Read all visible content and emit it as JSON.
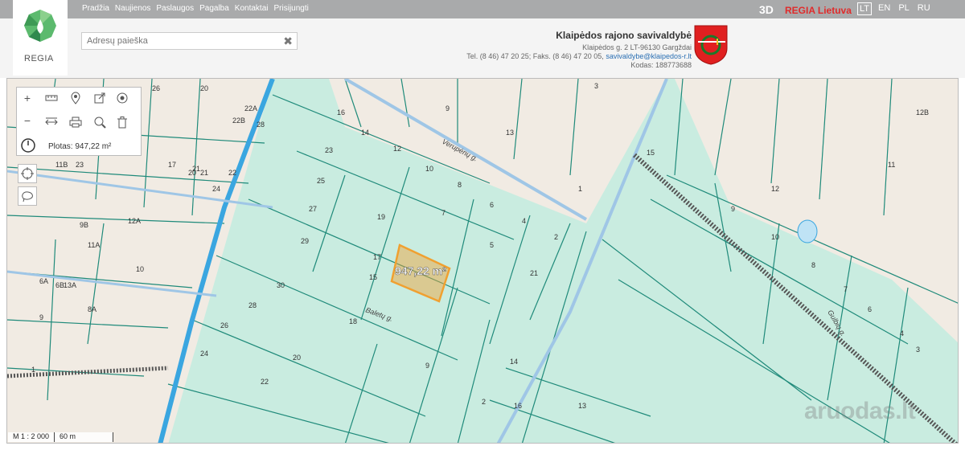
{
  "nav": {
    "items": [
      "Pradžia",
      "Naujienos",
      "Paslaugos",
      "Pagalba",
      "Kontaktai",
      "Prisijungti"
    ],
    "three_d": "3D",
    "regia_lietuva": "REGIA Lietuva",
    "languages": [
      "LT",
      "EN",
      "PL",
      "RU"
    ],
    "active_language": "LT"
  },
  "brand": {
    "name": "REGIA"
  },
  "search": {
    "placeholder": "Adresų paieška",
    "value": ""
  },
  "municipality": {
    "name": "Klaipėdos rajono savivaldybė",
    "address": "Klaipėdos g. 2 LT-96130 Gargždai",
    "phones": "Tel. (8 46) 47 20 25; Faks. (8 46) 47 20 05,",
    "email": "savivaldybe@klaipedos-r.lt",
    "code": "Kodas: 188773688"
  },
  "tools": {
    "area_label": "Plotas: 947,22 m²"
  },
  "map": {
    "measure_label": "947,22 m²",
    "streets": [
      "Verupėnų g.",
      "Baletų g.",
      "Gulbių g."
    ],
    "parcel_numbers": [
      "3",
      "9",
      "13",
      "12B",
      "16",
      "14",
      "12",
      "10",
      "8",
      "6",
      "4",
      "2",
      "1",
      "7",
      "5",
      "21",
      "19",
      "17",
      "15",
      "23",
      "25",
      "27",
      "29",
      "30",
      "28",
      "26",
      "24",
      "22",
      "20",
      "18",
      "11",
      "15",
      "12",
      "9",
      "10",
      "8",
      "7",
      "6",
      "4",
      "3",
      "2",
      "16",
      "14",
      "13",
      "9",
      "22",
      "24",
      "20",
      "21",
      "23",
      "11B",
      "9B",
      "11A",
      "12A",
      "13A",
      "10",
      "6A",
      "6B",
      "8A",
      "9",
      "17",
      "21",
      "1",
      "5",
      "26",
      "28",
      "22A",
      "22B",
      "20"
    ]
  },
  "scale": {
    "ratio": "M 1 : 2 000",
    "distance": "60 m"
  },
  "watermark": "aruodas.lt",
  "colors": {
    "parcel_fill": "#c9ece0",
    "parcel_line": "#1f8a7a",
    "highlight": "#f0a030",
    "river": "#3aa6e0",
    "topbar": "#a9aaab"
  }
}
